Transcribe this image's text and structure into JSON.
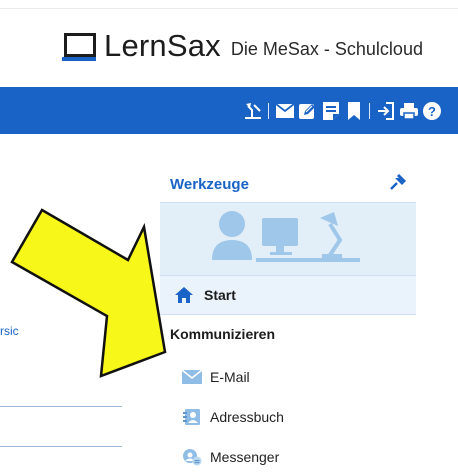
{
  "header": {
    "brand": "LernSax",
    "tagline": "Die MeSax - Schulcloud"
  },
  "toolbar": {
    "icons": [
      "tools-lamp-icon",
      "mail-icon",
      "edit-icon",
      "notes-icon",
      "bookmark-icon",
      "login-icon",
      "print-icon",
      "help-icon"
    ]
  },
  "left": {
    "snippet": "rsic"
  },
  "tools_panel": {
    "title": "Werkzeuge",
    "start_label": "Start",
    "section_label": "Kommunizieren",
    "items": [
      {
        "label": "E-Mail",
        "icon": "mail-icon"
      },
      {
        "label": "Adressbuch",
        "icon": "addressbook-icon"
      },
      {
        "label": "Messenger",
        "icon": "messenger-icon"
      }
    ]
  },
  "colors": {
    "brand_blue": "#1a63c6",
    "panel_light": "#e2eef8",
    "illustration": "#9ec7ea",
    "arrow_yellow": "#f7f71a"
  }
}
